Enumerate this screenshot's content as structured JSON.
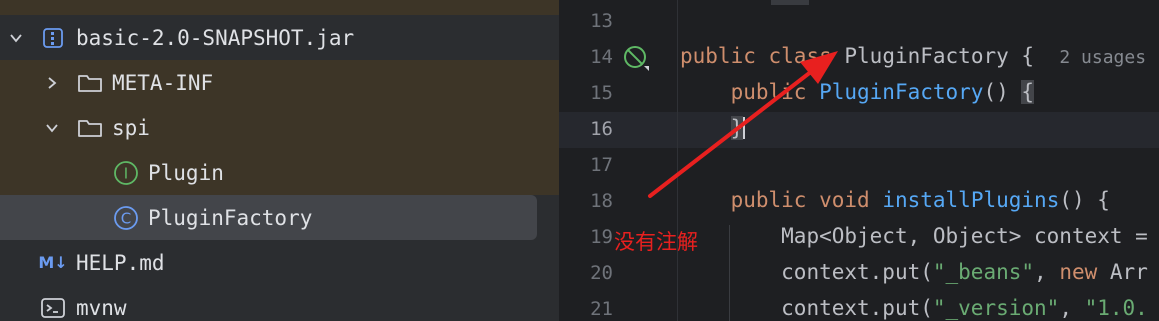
{
  "project_tree": {
    "items": [
      {
        "label": "basic-2.0-SNAPSHOT.jar",
        "icon": "archive-icon",
        "expanded": true
      },
      {
        "label": "META-INF",
        "icon": "folder-icon",
        "expanded": false
      },
      {
        "label": "spi",
        "icon": "folder-icon",
        "expanded": true
      },
      {
        "label": "Plugin",
        "icon": "interface-icon",
        "glyph": "I"
      },
      {
        "label": "PluginFactory",
        "icon": "class-icon",
        "glyph": "C",
        "selected": true
      },
      {
        "label": "HELP.md",
        "icon": "markdown-icon",
        "glyph": "M↓"
      },
      {
        "label": "mvnw",
        "icon": "terminal-icon"
      }
    ]
  },
  "editor": {
    "line_numbers": [
      "13",
      "14",
      "15",
      "16",
      "17",
      "18",
      "19",
      "20",
      "21"
    ],
    "code": {
      "l14_kw1": "public",
      "l14_kw2": "class",
      "l14_name": "PluginFactory",
      "l14_brace": "{",
      "l14_hint": "2 usages",
      "l15_kw": "public",
      "l15_fn": "PluginFactory",
      "l15_rest": "() ",
      "l15_brace": "{",
      "l16_brace": "}",
      "l18_kw1": "public",
      "l18_kw2": "void",
      "l18_fn": "installPlugins",
      "l18_rest": "() {",
      "l19": "Map<Object, Object> context =",
      "l20_pre": "context.put(",
      "l20_str": "\"_beans\"",
      "l20_mid": ", ",
      "l20_kw": "new",
      "l20_post": " Arr",
      "l21_pre": "context.put(",
      "l21_str1": "\"_version\"",
      "l21_mid": ", ",
      "l21_str2": "\"1.0."
    }
  },
  "annotation": {
    "text": "没有注解",
    "color": "#e8201f"
  },
  "colors": {
    "keyword": "#cf8e6d",
    "function": "#56a8f5",
    "string": "#6aab73",
    "text": "#bcbec4"
  }
}
